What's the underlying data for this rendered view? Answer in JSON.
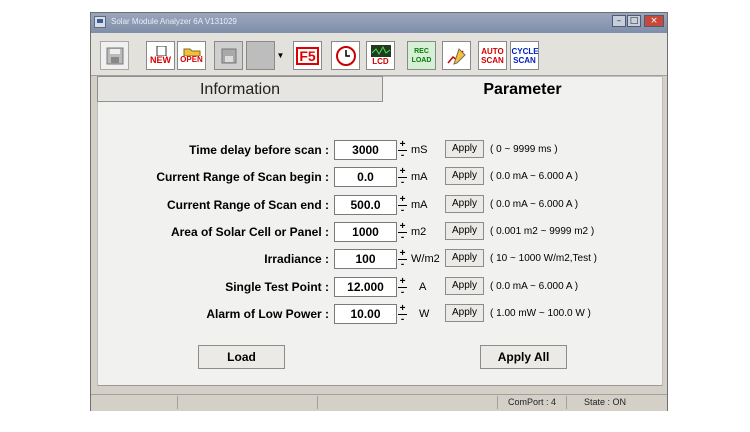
{
  "window": {
    "title": "Solar Module Analyzer 6A V131029"
  },
  "toolbar": {
    "tools": [
      {
        "name": "save-icon",
        "label": ""
      },
      {
        "name": "new-icon",
        "label": "NEW"
      },
      {
        "name": "open-icon",
        "label": "OPEN"
      },
      {
        "name": "disk-icon",
        "label": ""
      },
      {
        "name": "blank-icon",
        "label": ""
      },
      {
        "name": "f5-icon",
        "label": "F5"
      },
      {
        "name": "clock-icon",
        "label": ""
      },
      {
        "name": "lcd-icon",
        "label": "LCD"
      },
      {
        "name": "rec-load-icon",
        "label": "REC LOAD"
      },
      {
        "name": "chart-pen-icon",
        "label": ""
      },
      {
        "name": "auto-scan-icon",
        "label": "AUTO SCAN"
      },
      {
        "name": "cycle-scan-icon",
        "label": "CYCLE SCAN"
      }
    ]
  },
  "tabs": {
    "information": "Information",
    "parameter": "Parameter"
  },
  "parameters": [
    {
      "label": "Time delay before scan :",
      "value": "3000",
      "unit": "mS",
      "apply": "Apply",
      "range": "( 0 ~ 9999 ms )"
    },
    {
      "label": "Current Range of Scan begin :",
      "value": "0.0",
      "unit": "mA",
      "apply": "Apply",
      "range": "( 0.0 mA ~ 6.000 A )"
    },
    {
      "label": "Current Range of Scan end :",
      "value": "500.0",
      "unit": "mA",
      "apply": "Apply",
      "range": "( 0.0 mA ~ 6.000 A )"
    },
    {
      "label": "Area of Solar Cell or Panel :",
      "value": "1000",
      "unit": "m2",
      "apply": "Apply",
      "range": "( 0.001 m2 ~ 9999 m2 )"
    },
    {
      "label": "Irradiance :",
      "value": "100",
      "unit": "W/m2",
      "apply": "Apply",
      "range": "( 10 ~ 1000 W/m2,Test )"
    },
    {
      "label": "Single Test Point :",
      "value": "12.000",
      "unit": "A",
      "apply": "Apply",
      "range": "( 0.0 mA ~ 6.000 A )"
    },
    {
      "label": "Alarm of Low Power :",
      "value": "10.00",
      "unit": "W",
      "apply": "Apply",
      "range": "( 1.00 mW ~ 100.0 W )"
    }
  ],
  "buttons": {
    "load": "Load",
    "apply_all": "Apply All"
  },
  "spinner": {
    "up": "+",
    "down": "-"
  },
  "status": {
    "comport": "ComPort : 4",
    "state": "State : ON"
  }
}
